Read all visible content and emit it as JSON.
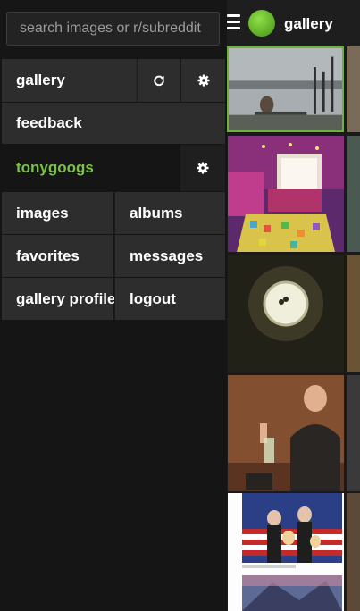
{
  "search": {
    "placeholder": "search images or r/subreddit"
  },
  "sidebar": {
    "gallery_label": "gallery",
    "feedback_label": "feedback",
    "username": "tonygoogs",
    "menu": {
      "images": "images",
      "albums": "albums",
      "favorites": "favorites",
      "messages": "messages",
      "gallery_profile": "gallery profile",
      "logout": "logout"
    }
  },
  "topbar": {
    "title": "gallery"
  },
  "icons": {
    "refresh": "refresh-icon",
    "settings": "gear-icon",
    "menu": "hamburger-icon",
    "logo": "logo-circle"
  },
  "colors": {
    "accent_green": "#7bc143",
    "logo_green": "#5aa824",
    "sidebar_bg": "#151515",
    "row_bg": "#2d2d2d"
  }
}
